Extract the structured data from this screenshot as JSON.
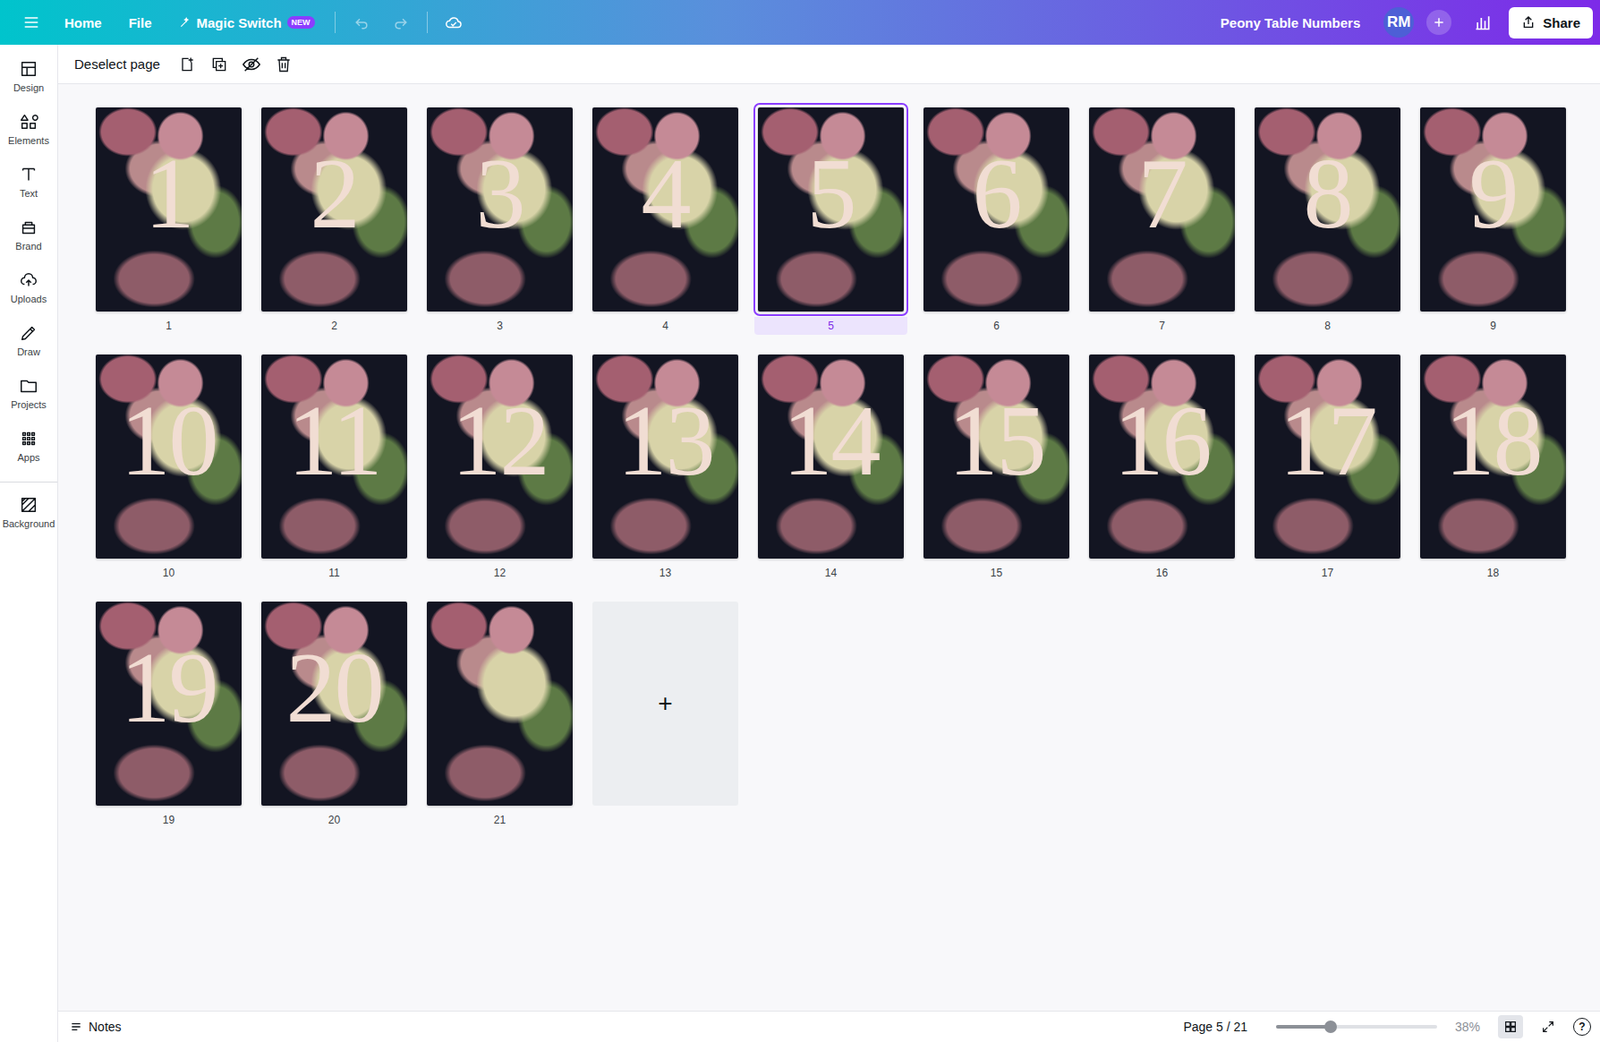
{
  "topbar": {
    "menu_items": [
      {
        "label": "Home"
      },
      {
        "label": "File"
      }
    ],
    "magic_switch": {
      "label": "Magic Switch",
      "badge": "NEW"
    },
    "history": [
      {
        "kind": "undo",
        "disabled": true
      },
      {
        "kind": "redo",
        "disabled": true
      }
    ],
    "title": "Peony Table Numbers",
    "avatar": "RM",
    "share": "Share"
  },
  "sidebar": {
    "items": [
      {
        "label": "Design"
      },
      {
        "label": "Elements"
      },
      {
        "label": "Text"
      },
      {
        "label": "Brand"
      },
      {
        "label": "Uploads"
      },
      {
        "label": "Draw"
      },
      {
        "label": "Projects"
      },
      {
        "label": "Apps"
      },
      {
        "label": "Background"
      }
    ]
  },
  "toolbar": {
    "deselect": "Deselect page"
  },
  "pages": [
    {
      "label": "1",
      "number": "1",
      "selected": false
    },
    {
      "label": "2",
      "number": "2",
      "selected": false
    },
    {
      "label": "3",
      "number": "3",
      "selected": false
    },
    {
      "label": "4",
      "number": "4",
      "selected": false
    },
    {
      "label": "5",
      "number": "5",
      "selected": true
    },
    {
      "label": "6",
      "number": "6",
      "selected": false
    },
    {
      "label": "7",
      "number": "7",
      "selected": false
    },
    {
      "label": "8",
      "number": "8",
      "selected": false
    },
    {
      "label": "9",
      "number": "9",
      "selected": false
    },
    {
      "label": "10",
      "number": "10",
      "selected": false
    },
    {
      "label": "11",
      "number": "11",
      "selected": false
    },
    {
      "label": "12",
      "number": "12",
      "selected": false
    },
    {
      "label": "13",
      "number": "13",
      "selected": false
    },
    {
      "label": "14",
      "number": "14",
      "selected": false
    },
    {
      "label": "15",
      "number": "15",
      "selected": false
    },
    {
      "label": "16",
      "number": "16",
      "selected": false
    },
    {
      "label": "17",
      "number": "17",
      "selected": false
    },
    {
      "label": "18",
      "number": "18",
      "selected": false
    },
    {
      "label": "19",
      "number": "19",
      "selected": false
    },
    {
      "label": "20",
      "number": "20",
      "selected": false
    },
    {
      "label": "21",
      "number": "",
      "selected": false
    }
  ],
  "add_page": {
    "label": "+"
  },
  "bottom_bar": {
    "notes": "Notes",
    "page_indicator": "Page 5 / 21",
    "zoom": {
      "level": 0.34,
      "reading": "38%"
    },
    "grid_view_selected": true,
    "help": "?"
  }
}
